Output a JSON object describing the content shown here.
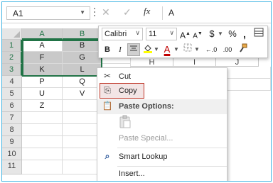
{
  "formula_bar": {
    "name_box": "A1",
    "formula_value": "A",
    "cancel_glyph": "✕",
    "enter_glyph": "✓",
    "fx_glyph": "fx"
  },
  "grid": {
    "columns": [
      "A",
      "B"
    ],
    "rows": [
      "1",
      "2",
      "3",
      "4",
      "5",
      "6",
      "7",
      "8",
      "9",
      "10",
      "11"
    ],
    "cells": [
      [
        "A",
        "B"
      ],
      [
        "F",
        "G"
      ],
      [
        "K",
        "L"
      ],
      [
        "P",
        "Q"
      ],
      [
        "U",
        "V"
      ],
      [
        "Z",
        ""
      ]
    ],
    "partial_headers": [
      "H",
      "I",
      "J"
    ]
  },
  "mini_toolbar": {
    "font_name": "Calibri",
    "font_size": "11",
    "grow_font": "A",
    "shrink_font": "A",
    "currency": "$",
    "percent": "%",
    "comma": ",",
    "bold": "B",
    "italic": "I",
    "font_color_letter": "A",
    "increase_decimal": "←.0",
    "decrease_decimal": ".00",
    "fill_color": "#ffff00",
    "font_color": "#c00000"
  },
  "context_menu": {
    "items": [
      {
        "label": "Cut",
        "accel": "t",
        "icon": "scissors-icon",
        "glyph": "✂"
      },
      {
        "label": "Copy",
        "accel": "C",
        "icon": "copy-icon",
        "glyph": "⎘"
      },
      {
        "label": "Paste Options:",
        "icon": "paste-icon",
        "glyph": "📋"
      },
      {
        "label": "Paste Special...",
        "icon": "",
        "glyph": ""
      },
      {
        "label": "Smart Lookup",
        "icon": "smart-lookup-icon",
        "glyph": "⌕"
      },
      {
        "label": "Insert...",
        "icon": "",
        "glyph": ""
      }
    ]
  },
  "colors": {
    "excel_green": "#217346",
    "selection_fill": "#c9c9c9",
    "highlight_border": "#c0392b",
    "frame_border": "#44b6e3"
  }
}
